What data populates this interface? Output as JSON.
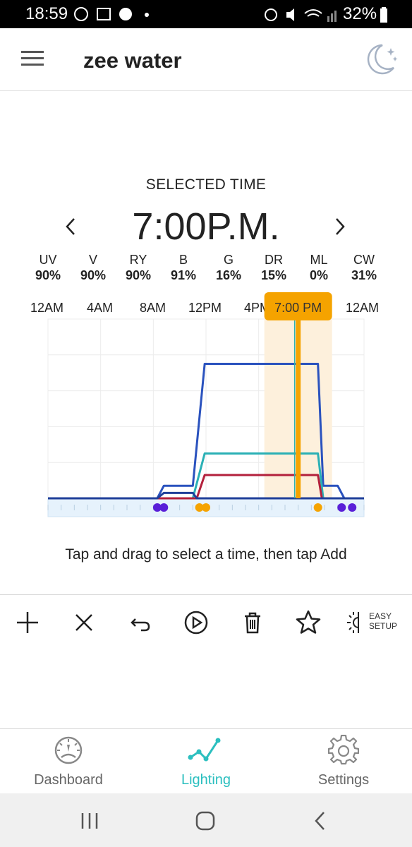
{
  "status_bar": {
    "time": "18:59",
    "battery": "32%"
  },
  "header": {
    "title": "zee water"
  },
  "selected": {
    "label": "SELECTED TIME",
    "time": "7:00P.M.",
    "marker_label": "7:00 PM",
    "hint": "Tap and drag to select a time, then tap Add"
  },
  "channels": [
    {
      "name": "UV",
      "value": "90%"
    },
    {
      "name": "V",
      "value": "90%"
    },
    {
      "name": "RY",
      "value": "90%"
    },
    {
      "name": "B",
      "value": "91%"
    },
    {
      "name": "G",
      "value": "16%"
    },
    {
      "name": "DR",
      "value": "15%"
    },
    {
      "name": "ML",
      "value": "0%"
    },
    {
      "name": "CW",
      "value": "31%"
    }
  ],
  "time_ticks": [
    "12AM",
    "4AM",
    "8AM",
    "12PM",
    "4PM",
    "12AM"
  ],
  "toolbar": {
    "easy_setup_line1": "EASY",
    "easy_setup_line2": "SETUP"
  },
  "nav": {
    "dashboard": "Dashboard",
    "lighting": "Lighting",
    "settings": "Settings"
  },
  "colors": {
    "accent_teal": "#2bbfbf",
    "marker_orange": "#f5a300",
    "series_blue": "#2a52be",
    "series_teal": "#2ab0b5",
    "series_red": "#b3203c",
    "series_navy": "#1f3f9a"
  },
  "chart_data": {
    "type": "line",
    "x_unit": "hour of day",
    "xlim": [
      0,
      24
    ],
    "ylim": [
      0,
      100
    ],
    "selected_hour": 19,
    "series": [
      {
        "color": "#2a52be",
        "points": [
          [
            0,
            0
          ],
          [
            8.3,
            0
          ],
          [
            8.8,
            7
          ],
          [
            11,
            7
          ],
          [
            11.9,
            75
          ],
          [
            20.5,
            75
          ],
          [
            20.9,
            7
          ],
          [
            22,
            7
          ],
          [
            22.5,
            0
          ],
          [
            24,
            0
          ]
        ]
      },
      {
        "color": "#2ab0b5",
        "points": [
          [
            0,
            0
          ],
          [
            11,
            0
          ],
          [
            11.9,
            25
          ],
          [
            20.5,
            25
          ],
          [
            20.9,
            0
          ],
          [
            24,
            0
          ]
        ]
      },
      {
        "color": "#b3203c",
        "points": [
          [
            0,
            0
          ],
          [
            11.3,
            0
          ],
          [
            11.9,
            13
          ],
          [
            20.5,
            13
          ],
          [
            20.8,
            0
          ],
          [
            24,
            0
          ]
        ]
      },
      {
        "color": "#1f3f9a",
        "points": [
          [
            0,
            0
          ],
          [
            8.3,
            0
          ],
          [
            8.8,
            3
          ],
          [
            11,
            3
          ],
          [
            11.3,
            0
          ],
          [
            24,
            0
          ]
        ]
      }
    ],
    "markers": [
      {
        "hour": 8.3,
        "color": "#5a1fd8"
      },
      {
        "hour": 8.8,
        "color": "#5a1fd8"
      },
      {
        "hour": 11.5,
        "color": "#f5a300"
      },
      {
        "hour": 12.0,
        "color": "#f5a300"
      },
      {
        "hour": 20.5,
        "color": "#f5a300"
      },
      {
        "hour": 22.3,
        "color": "#5a1fd8"
      },
      {
        "hour": 23.1,
        "color": "#5a1fd8"
      }
    ]
  }
}
